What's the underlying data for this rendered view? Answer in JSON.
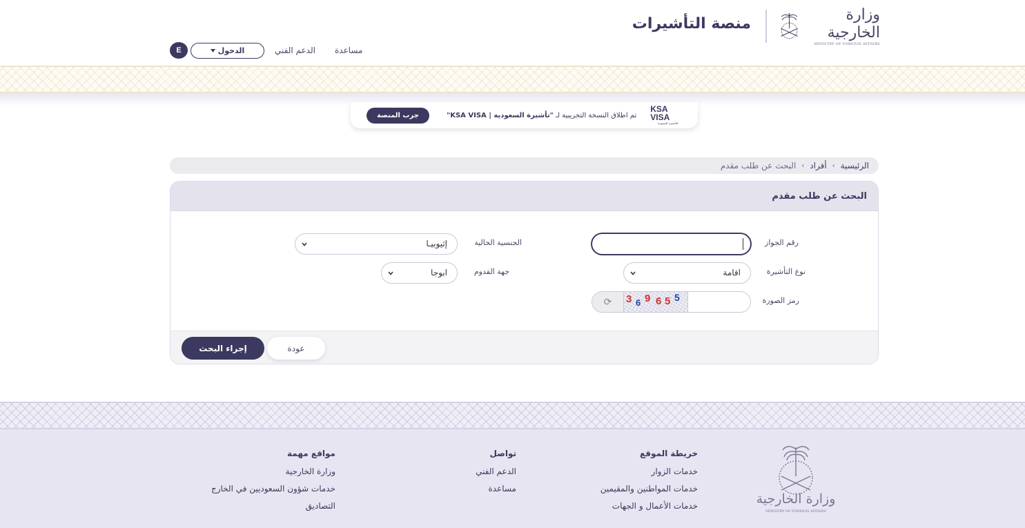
{
  "header": {
    "logo_ar": "وزارة الخارجية",
    "logo_en": "MINISTRY OF FOREIGN AFFAIRS",
    "platform_title": "منصة التأشيرات",
    "nav": {
      "help": "مساعدة",
      "support": "الدعم الفني",
      "login": "الدخول",
      "lang": "E"
    }
  },
  "announcement": {
    "text_prefix": "تم اطلاق النسخة التجريبية لـ",
    "text_bold": "\"تأشيرة السعودية | KSA VISA\"",
    "button": "جرب المنصة",
    "logo_line1": "KSA",
    "logo_line2": "VISA",
    "logo_sub": "التأشيرة السعودية"
  },
  "breadcrumb": {
    "home": "الرئيسية",
    "individuals": "أفراد",
    "current": "البحث عن طلب مقدم"
  },
  "form": {
    "title": "البحث عن طلب مقدم",
    "passport_label": "رقم الجواز",
    "passport_value": "",
    "nationality_label": "الجنسية الحالية",
    "nationality_value": "إثيوبيـا",
    "visa_type_label": "نوع التأشيرة",
    "visa_type_value": "اقامة",
    "arrival_label": "جهة القدوم",
    "arrival_value": "ابوجا",
    "captcha_label": "رمز الصورة",
    "captcha_input_value": "",
    "captcha_digits": [
      "3",
      "6",
      "9",
      "6",
      "5",
      "5"
    ],
    "search_button": "إجراء البحث",
    "back_button": "عودة"
  },
  "footer": {
    "sitemap": {
      "title": "خريطة الموقع",
      "links": [
        "خدمات الزوار",
        "خدمات المواطنين والمقيمين",
        "خدمات الأعمال و الجهات"
      ]
    },
    "contact": {
      "title": "تواصل",
      "links": [
        "الدعم الفني",
        "مساعدة"
      ]
    },
    "important": {
      "title": "مواقع مهمة",
      "links": [
        "وزارة الخارجية",
        "خدمات شؤون السعوديين في الخارج",
        "التصاديق"
      ]
    },
    "logo_ar": "وزارة الخارجية",
    "logo_en": "MINISTRY OF FOREIGN AFFAIRS"
  },
  "colors": {
    "primary": "#3b3960",
    "captcha_red": "#d0342c",
    "captcha_blue": "#1f3fb3"
  }
}
